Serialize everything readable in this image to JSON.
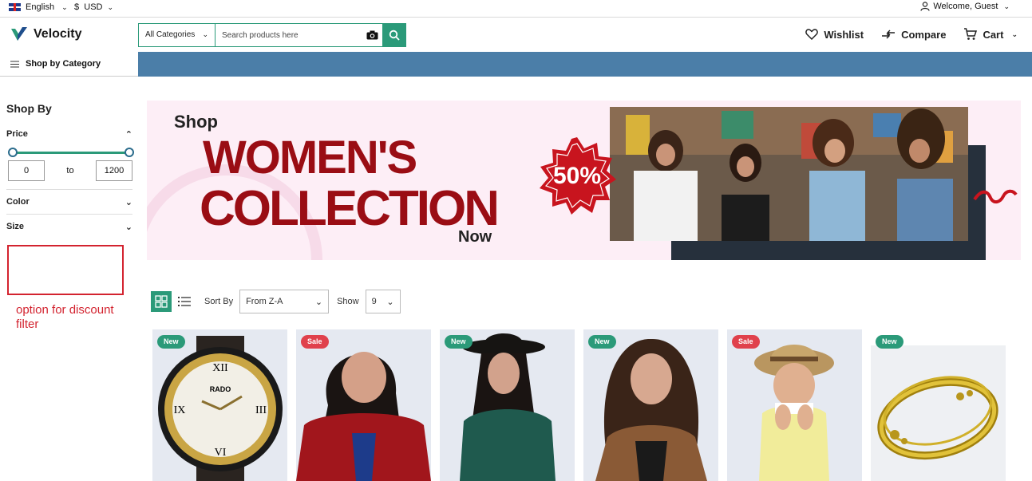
{
  "topbar": {
    "language": "English",
    "currency_symbol": "$",
    "currency": "USD",
    "welcome": "Welcome, Guest"
  },
  "header": {
    "logo_text": "Velocity",
    "category_select": "All Categories",
    "search_placeholder": "Search products here",
    "wishlist": "Wishlist",
    "compare": "Compare",
    "cart": "Cart"
  },
  "nav": {
    "shop_by_category": "Shop by Category"
  },
  "sidebar": {
    "title": "Shop By",
    "price_label": "Price",
    "price_min": "0",
    "price_to": "to",
    "price_max": "1200",
    "color_label": "Color",
    "size_label": "Size",
    "annotation": "option for discount filter"
  },
  "banner": {
    "shop": "Shop",
    "women": "WOMEN'S",
    "collection": "COLLECTION",
    "now": "Now",
    "discount": "50%"
  },
  "toolbar": {
    "sort_by_label": "Sort By",
    "sort_value": "From Z-A",
    "show_label": "Show",
    "show_value": "9"
  },
  "products": [
    {
      "tag": "New",
      "type": "new",
      "image": "wristwatch"
    },
    {
      "tag": "Sale",
      "type": "sale",
      "image": "woman-red-jacket"
    },
    {
      "tag": "New",
      "type": "new",
      "image": "woman-green-sweater-hat"
    },
    {
      "tag": "New",
      "type": "new",
      "image": "woman-brown-jacket"
    },
    {
      "tag": "Sale",
      "type": "sale",
      "image": "girl-straw-hat"
    },
    {
      "tag": "New",
      "type": "new",
      "image": "gold-bangle"
    }
  ],
  "colors": {
    "accent": "#2b9a79",
    "nav_blue": "#4b7ea8",
    "sale": "#e0414c",
    "banner_red": "#9a0d14"
  }
}
